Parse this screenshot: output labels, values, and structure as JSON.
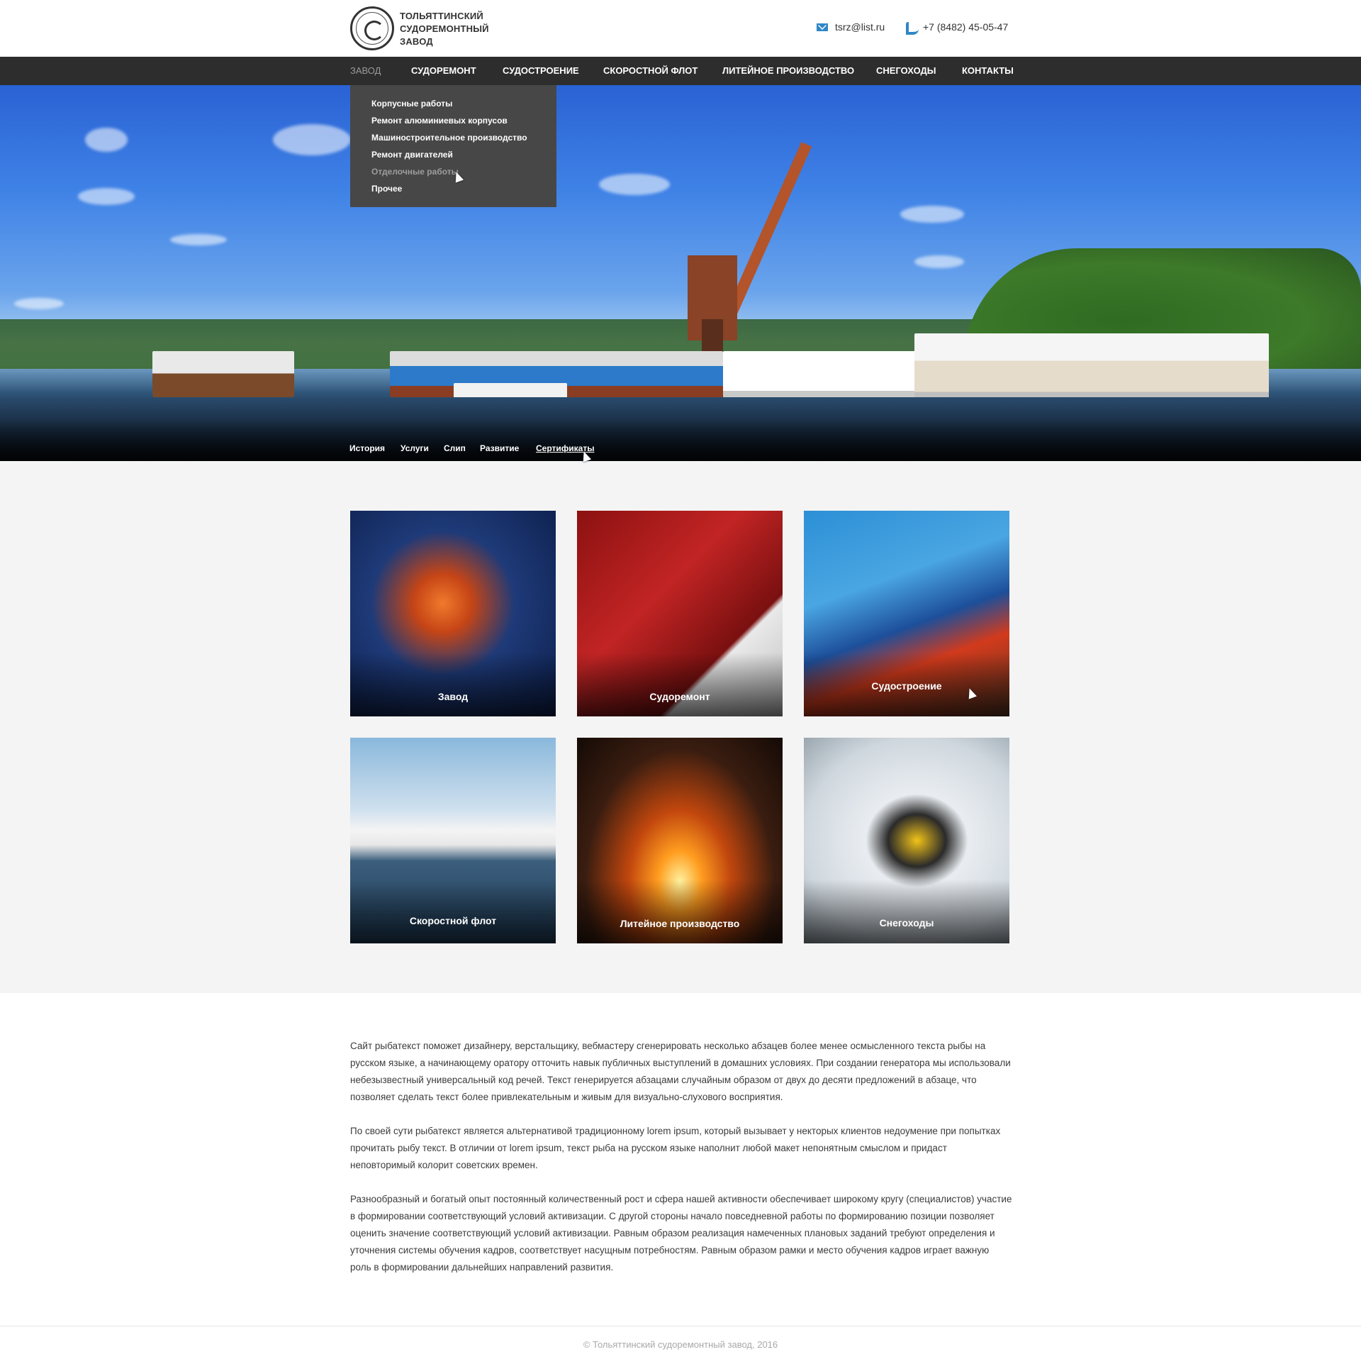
{
  "header": {
    "logo_lines": [
      "Тольяттинский",
      "судоремонтный",
      "завод"
    ],
    "email": "tsrz@list.ru",
    "phone": "+7 (8482) 45-05-47"
  },
  "nav": {
    "items": [
      "Завод",
      "Судоремонт",
      "Судостроение",
      "Скоростной флот",
      "Литейное производство",
      "Снегоходы",
      "Контакты"
    ],
    "active": "Завод"
  },
  "dropdown": {
    "items": [
      "Корпусные работы",
      "Ремонт алюминиевых корпусов",
      "Машиностроительное производство",
      "Ремонт двигателей",
      "Отделочные работы",
      "Прочее"
    ],
    "hovered": "Отделочные работы"
  },
  "subnav": {
    "items": [
      "История",
      "Услуги",
      "Слип",
      "Развитие",
      "Сертификаты"
    ],
    "active": "Сертификаты"
  },
  "tiles": [
    {
      "label": "Завод",
      "theme": "offshore-rig-night"
    },
    {
      "label": "Судоремонт",
      "theme": "hull-painting"
    },
    {
      "label": "Судостроение",
      "theme": "ship-drydock"
    },
    {
      "label": "Скоростной флот",
      "theme": "hydrofoil"
    },
    {
      "label": "Литейное производство",
      "theme": "foundry-ladle"
    },
    {
      "label": "Снегоходы",
      "theme": "snowmobile"
    }
  ],
  "content": {
    "paragraphs": [
      "Сайт рыбатекст поможет дизайнеру, верстальщику, вебмастеру сгенерировать несколько абзацев более менее осмысленного текста рыбы на русском языке, а начинающему оратору отточить навык публичных выступлений в домашних условиях. При создании генератора мы использовали небезызвестный универсальный код речей. Текст генерируется абзацами случайным образом от двух до десяти предложений в абзаце, что позволяет сделать текст более привлекательным и живым для визуально-слухового восприятия.",
      "По своей сути рыбатекст является альтернативой традиционному lorem ipsum, который вызывает у некторых клиентов недоумение при попытках прочитать рыбу текст. В отличии от lorem ipsum, текст рыба на русском языке наполнит любой макет непонятным смыслом и придаст неповторимый колорит советских времен.",
      "Разнообразный и богатый опыт постоянный количественный рост и сфера нашей активности обеспечивает широкому кругу (специалистов) участие в формировании соответствующий условий активизации. С другой стороны начало повседневной работы по формированию позиции позволяет оценить значение соответствующий условий активизации. Равным образом реализация намеченных плановых заданий требуют определения и уточнения системы обучения кадров, соответствует насущным потребностям. Равным образом рамки и место обучения кадров играет важную роль в формировании дальнейших направлений развития."
    ]
  },
  "footer": {
    "copyright": "© Тольяттинский судоремонтный завод, 2016"
  },
  "colors": {
    "nav_bg": "#2d2d2d",
    "dropdown_bg": "#474747",
    "icon_accent": "#2f86c6",
    "tiles_section_bg": "#f4f4f4"
  }
}
